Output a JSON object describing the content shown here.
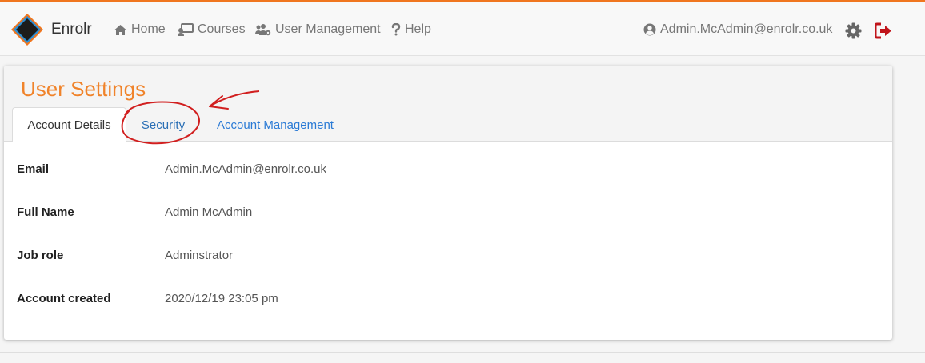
{
  "brand": {
    "name": "Enrolr"
  },
  "nav": {
    "home": "Home",
    "courses": "Courses",
    "user_management": "User Management",
    "help": "Help",
    "user_email": "Admin.McAdmin@enrolr.co.uk"
  },
  "icons": {
    "home": "home-icon",
    "courses": "chalkboard-teacher-icon",
    "user_management": "users-cog-icon",
    "help": "question-icon",
    "user": "user-circle-icon",
    "settings": "gear-icon",
    "logout": "sign-out-icon"
  },
  "page": {
    "title": "User Settings",
    "tabs": [
      {
        "label": "Account Details",
        "active": true
      },
      {
        "label": "Security",
        "active": false
      },
      {
        "label": "Account Management",
        "active": false
      }
    ]
  },
  "details": [
    {
      "label": "Email",
      "value": "Admin.McAdmin@enrolr.co.uk"
    },
    {
      "label": "Full Name",
      "value": "Admin McAdmin"
    },
    {
      "label": "Job role",
      "value": "Adminstrator"
    },
    {
      "label": "Account created",
      "value": "2020/12/19 23:05 pm"
    }
  ],
  "colors": {
    "accent": "#f0761f",
    "title": "#f0832a",
    "link": "#2a7ad5",
    "logout": "#c0141a",
    "annotation": "#d11f1f"
  }
}
